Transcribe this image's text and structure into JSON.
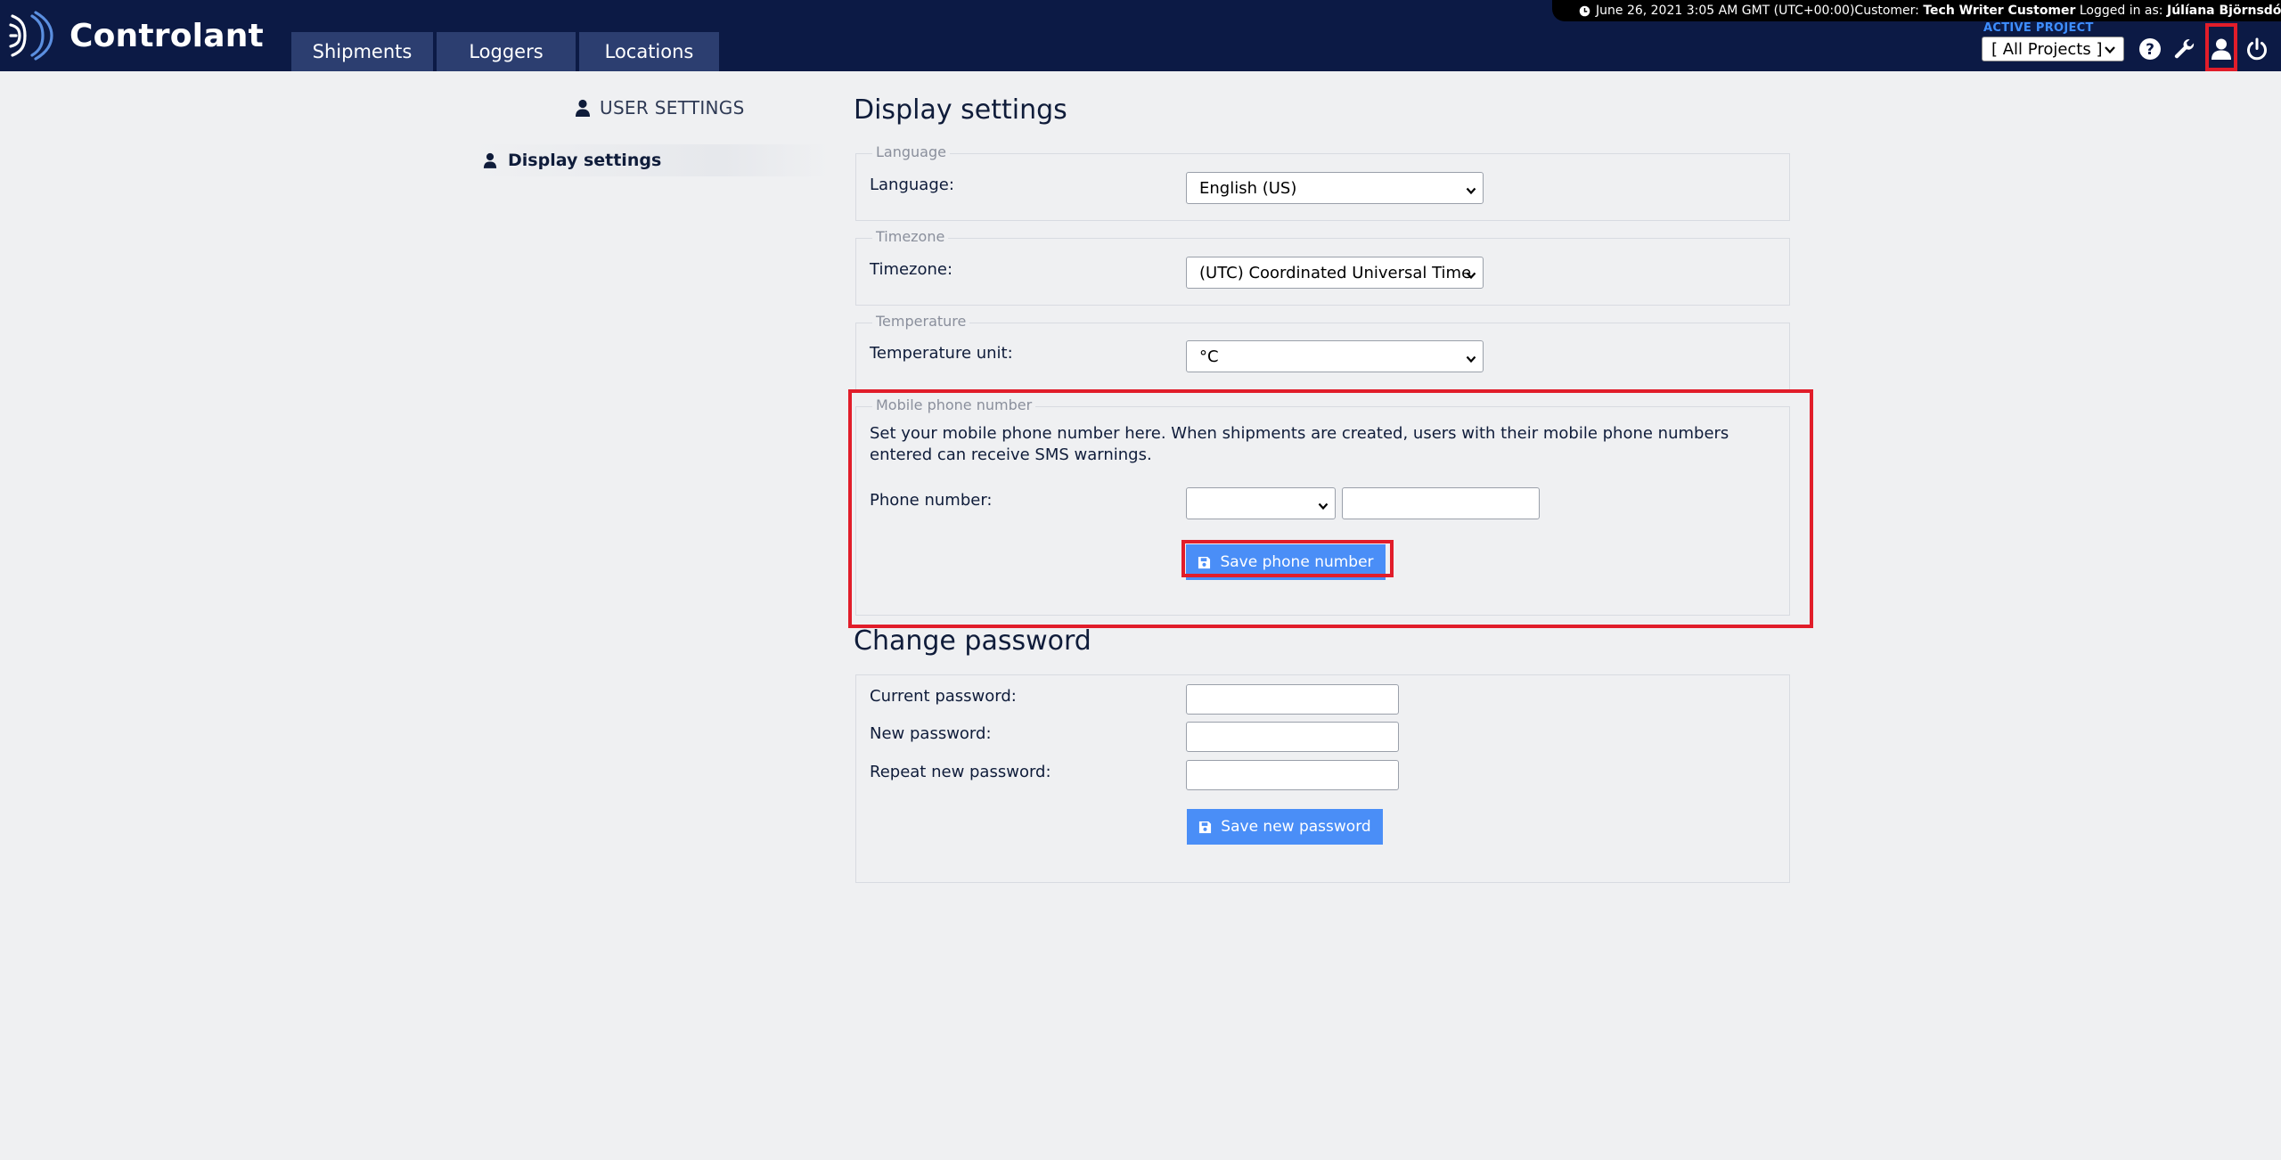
{
  "app": {
    "brand": "Controlant",
    "nav_tabs": [
      {
        "label": "Shipments"
      },
      {
        "label": "Loggers"
      },
      {
        "label": "Locations"
      }
    ]
  },
  "infobar": {
    "datetime": "June 26, 2021 3:05 AM GMT (UTC+00:00)",
    "customer_label": "Customer:",
    "customer_name": "Tech Writer Customer",
    "logged_in_label": "Logged in as:",
    "user_name": "Júlíana Björnsdóttir (ADMIN)"
  },
  "project": {
    "label": "ACTIVE PROJECT",
    "selected": "[ All Projects ]"
  },
  "icons": [
    "help-icon",
    "wrench-icon",
    "user-icon",
    "power-icon"
  ],
  "sidebar": {
    "header": "USER SETTINGS",
    "items": [
      {
        "label": "Display settings"
      }
    ]
  },
  "display_settings": {
    "title": "Display settings",
    "language": {
      "legend": "Language",
      "label": "Language:",
      "value": "English (US)"
    },
    "timezone": {
      "legend": "Timezone",
      "label": "Timezone:",
      "value": "(UTC) Coordinated Universal Time"
    },
    "temperature": {
      "legend": "Temperature",
      "label": "Temperature unit:",
      "value": "°C"
    },
    "mobile": {
      "legend": "Mobile phone number",
      "description": "Set your mobile phone number here. When shipments are created, users with their mobile phone numbers entered can receive SMS warnings.",
      "label": "Phone number:",
      "country_code": "",
      "number": "",
      "save_label": "Save phone number"
    }
  },
  "change_password": {
    "title": "Change password",
    "current_label": "Current password:",
    "new_label": "New password:",
    "repeat_label": "Repeat new password:",
    "save_label": "Save new password"
  },
  "colors": {
    "topbar": "#0c1a45",
    "nav_tab": "#2c3e70",
    "accent": "#4a8ef7",
    "highlight": "#e11d2a",
    "background": "#eff0f2"
  }
}
